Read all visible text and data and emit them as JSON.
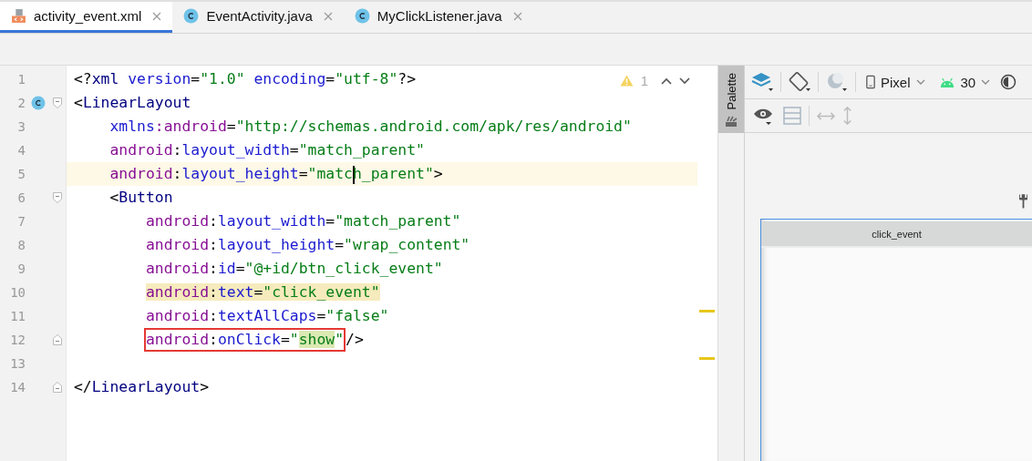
{
  "tabs": [
    {
      "label": "activity_event.xml",
      "kind": "xml",
      "selected": true
    },
    {
      "label": "EventActivity.java",
      "kind": "class",
      "selected": false
    },
    {
      "label": "MyClickListener.java",
      "kind": "class",
      "selected": false
    }
  ],
  "editor": {
    "warning_count": "1",
    "lines": [
      {
        "number": "1",
        "current": false,
        "parts": [
          {
            "boxed": false,
            "tokens": [
              {
                "text": "<?",
                "kind": "punct"
              },
              {
                "text": "xml",
                "kind": "tag"
              },
              {
                "text": " version",
                "kind": "attr"
              },
              {
                "text": "=",
                "kind": "punct"
              },
              {
                "text": "\"1.0\"",
                "kind": "value"
              },
              {
                "text": " encoding",
                "kind": "attr"
              },
              {
                "text": "=",
                "kind": "punct"
              },
              {
                "text": "\"utf-8\"",
                "kind": "value"
              },
              {
                "text": "?>",
                "kind": "punct"
              }
            ]
          }
        ]
      },
      {
        "number": "2",
        "current": false,
        "class_marker": true,
        "fold_start": true,
        "parts": [
          {
            "boxed": false,
            "tokens": [
              {
                "text": "<",
                "kind": "punct"
              },
              {
                "text": "LinearLayout",
                "kind": "tag"
              }
            ]
          }
        ]
      },
      {
        "number": "3",
        "current": false,
        "parts": [
          {
            "boxed": false,
            "tokens": [
              {
                "text": "    xmlns",
                "kind": "attr"
              },
              {
                "text": ":android",
                "kind": "ns"
              },
              {
                "text": "=",
                "kind": "punct"
              },
              {
                "text": "\"http://schemas.android.com/apk/res/android\"",
                "kind": "value"
              }
            ]
          }
        ]
      },
      {
        "number": "4",
        "current": false,
        "parts": [
          {
            "boxed": false,
            "tokens": [
              {
                "text": "    android",
                "kind": "ns"
              },
              {
                "text": ":",
                "kind": "punct"
              },
              {
                "text": "layout_width",
                "kind": "attr"
              },
              {
                "text": "=",
                "kind": "punct"
              },
              {
                "text": "\"match_parent\"",
                "kind": "value"
              }
            ]
          }
        ]
      },
      {
        "number": "5",
        "current": true,
        "parts": [
          {
            "boxed": false,
            "tokens": [
              {
                "text": "    android",
                "kind": "ns"
              },
              {
                "text": ":",
                "kind": "punct"
              },
              {
                "text": "layout_height",
                "kind": "attr"
              },
              {
                "text": "=",
                "kind": "punct"
              },
              {
                "text": "\"matc",
                "kind": "value",
                "caret_after": true
              },
              {
                "text": "h_parent\"",
                "kind": "value"
              },
              {
                "text": ">",
                "kind": "punct"
              }
            ]
          }
        ]
      },
      {
        "number": "6",
        "current": false,
        "fold_start": true,
        "parts": [
          {
            "boxed": false,
            "tokens": [
              {
                "text": "    <",
                "kind": "punct"
              },
              {
                "text": "Button",
                "kind": "tag"
              }
            ]
          }
        ]
      },
      {
        "number": "7",
        "current": false,
        "parts": [
          {
            "boxed": false,
            "tokens": [
              {
                "text": "        android",
                "kind": "ns"
              },
              {
                "text": ":",
                "kind": "punct"
              },
              {
                "text": "layout_width",
                "kind": "attr"
              },
              {
                "text": "=",
                "kind": "punct"
              },
              {
                "text": "\"match_parent\"",
                "kind": "value"
              }
            ]
          }
        ]
      },
      {
        "number": "8",
        "current": false,
        "parts": [
          {
            "boxed": false,
            "tokens": [
              {
                "text": "        android",
                "kind": "ns"
              },
              {
                "text": ":",
                "kind": "punct"
              },
              {
                "text": "layout_height",
                "kind": "attr"
              },
              {
                "text": "=",
                "kind": "punct"
              },
              {
                "text": "\"wrap_content\"",
                "kind": "value"
              }
            ]
          }
        ]
      },
      {
        "number": "9",
        "current": false,
        "parts": [
          {
            "boxed": false,
            "tokens": [
              {
                "text": "        android",
                "kind": "ns"
              },
              {
                "text": ":",
                "kind": "punct"
              },
              {
                "text": "id",
                "kind": "attr"
              },
              {
                "text": "=",
                "kind": "punct"
              },
              {
                "text": "\"@+id/btn_click_event\"",
                "kind": "value"
              }
            ]
          }
        ]
      },
      {
        "number": "10",
        "current": false,
        "parts": [
          {
            "boxed": false,
            "tokens": [
              {
                "text": "        android",
                "kind": "ns",
                "usage_highlight": true
              },
              {
                "text": ":",
                "kind": "punct",
                "usage_highlight": true
              },
              {
                "text": "text",
                "kind": "attr",
                "usage_highlight": true
              },
              {
                "text": "=",
                "kind": "punct",
                "usage_highlight": true
              },
              {
                "text": "\"click_event\"",
                "kind": "value",
                "usage_highlight": true
              }
            ]
          }
        ]
      },
      {
        "number": "11",
        "current": false,
        "parts": [
          {
            "boxed": false,
            "tokens": [
              {
                "text": "        android",
                "kind": "ns"
              },
              {
                "text": ":",
                "kind": "punct"
              },
              {
                "text": "textAllCaps",
                "kind": "attr"
              },
              {
                "text": "=",
                "kind": "punct"
              },
              {
                "text": "\"false\"",
                "kind": "value"
              }
            ]
          }
        ]
      },
      {
        "number": "12",
        "current": false,
        "fold_end": true,
        "parts": [
          {
            "boxed": true,
            "tokens": [
              {
                "text": "        android",
                "kind": "ns"
              },
              {
                "text": ":",
                "kind": "punct"
              },
              {
                "text": "onClick",
                "kind": "attr"
              },
              {
                "text": "=",
                "kind": "punct"
              },
              {
                "text": "\"",
                "kind": "value"
              },
              {
                "text": "show",
                "kind": "value",
                "match_highlight": true
              },
              {
                "text": "\"",
                "kind": "value"
              }
            ]
          },
          {
            "boxed": false,
            "tokens": [
              {
                "text": "/>",
                "kind": "punct"
              }
            ]
          }
        ]
      },
      {
        "number": "13",
        "current": false
      },
      {
        "number": "14",
        "current": false,
        "fold_end": true,
        "parts": [
          {
            "boxed": false,
            "tokens": [
              {
                "text": "</",
                "kind": "punct"
              },
              {
                "text": "LinearLayout",
                "kind": "tag"
              },
              {
                "text": ">",
                "kind": "punct"
              }
            ]
          }
        ]
      }
    ]
  },
  "palette": {
    "label": "Palette"
  },
  "design": {
    "device": "Pixel",
    "api": "30",
    "preview_button": "click_event"
  }
}
